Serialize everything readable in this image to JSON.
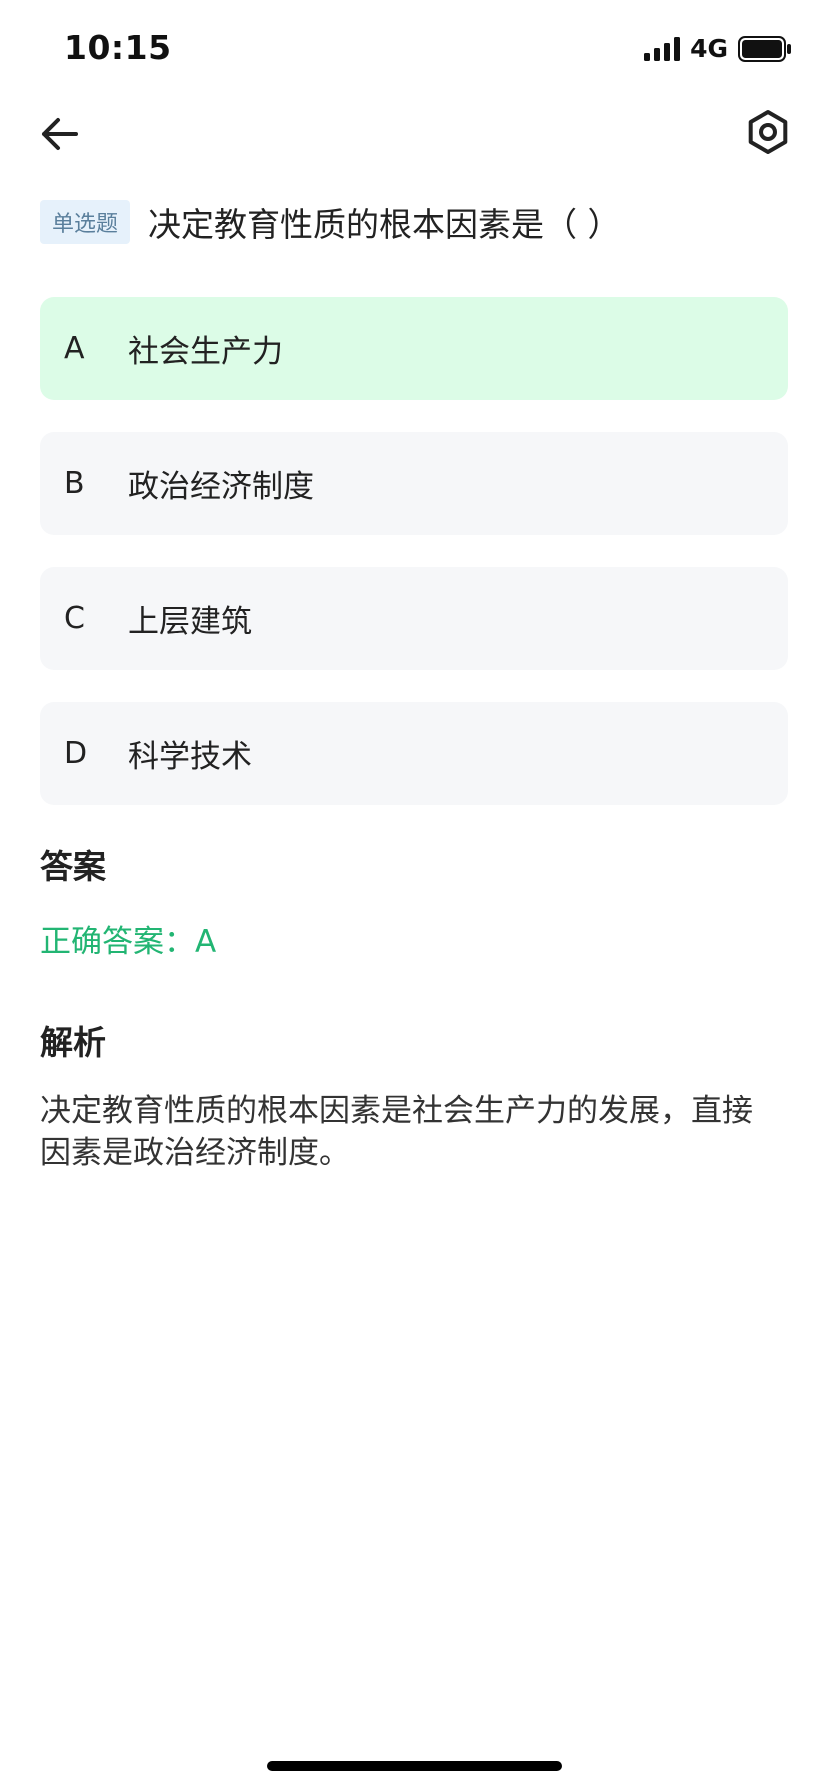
{
  "status_bar": {
    "time": "10:15",
    "network": "4G",
    "icons": [
      "signal-icon",
      "battery-icon"
    ]
  },
  "nav": {
    "back_icon": "back-arrow-icon",
    "settings_icon": "settings-hexagon-icon"
  },
  "question": {
    "type": "单选题",
    "text": "决定教育性质的根本因素是（ ）"
  },
  "options": [
    {
      "key": "A",
      "text": "社会生产力",
      "correct": true
    },
    {
      "key": "B",
      "text": "政治经济制度",
      "correct": false
    },
    {
      "key": "C",
      "text": "上层建筑",
      "correct": false
    },
    {
      "key": "D",
      "text": "科学技术",
      "correct": false
    }
  ],
  "answer": {
    "title": "答案",
    "label": "正确答案：A"
  },
  "analysis": {
    "title": "解析",
    "text": "决定教育性质的根本因素是社会生产力的发展，直接因素是政治经济制度。"
  },
  "colors": {
    "correct_bg": "#dcfce7",
    "option_bg": "#f6f7f9",
    "answer_green": "#22b573",
    "badge_bg": "#e6f1fb",
    "badge_text": "#5a7f9c"
  }
}
